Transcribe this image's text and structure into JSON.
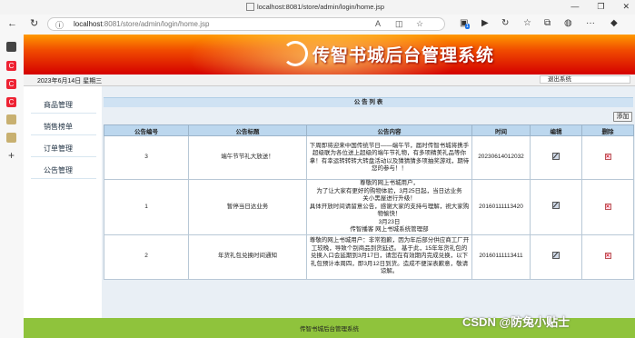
{
  "browser": {
    "tab_title": "localhost:8081/store/admin/login/home.jsp",
    "url_host": "localhost",
    "url_rest": ":8081/store/admin/login/home.jsp",
    "ext_badge": "1",
    "win_minimize": "—",
    "win_restore": "❐",
    "win_close": "✕"
  },
  "banner": {
    "title": "传智书城后台管理系统"
  },
  "infobar": {
    "date": "2023年6月14日 星期三",
    "logout": "退出系统"
  },
  "menu": {
    "items": [
      {
        "label": "商品管理"
      },
      {
        "label": "销售榜单"
      },
      {
        "label": "订单管理"
      },
      {
        "label": "公告管理"
      }
    ]
  },
  "panel": {
    "title": "公 告 列 表",
    "add_button": "添加"
  },
  "table": {
    "headers": [
      "公告编号",
      "公告标题",
      "公告内容",
      "时间",
      "编辑",
      "删除"
    ],
    "rows": [
      {
        "id": "3",
        "title": "端午节节礼大放送！",
        "content": "下周即将迎来中国传统节日——端午节，届时传智书城将携手超级联为各位送上超级的端午节礼物，有多项精美礼品等你拿！有幸运转转转大转盘活动以及猜猜猜多项抽奖游戏，期待您的参与！！",
        "time": "20230614012032"
      },
      {
        "id": "1",
        "title": "暂停当日达业务",
        "content": "尊敬的网上书城用户，\n为了让大家有更好的购物体验，3月25日起，当日达业务\n关小黑屋进行升级！\n具体开放时间请留意公告，感谢大家的支持与理解，祝大家购\n物愉快！\n3月23日\n传智播客 网上书城系统管理部",
        "time": "20160111113420"
      },
      {
        "id": "2",
        "title": "年货礼包兑换时间通知",
        "content": "尊敬的网上书城用户：非常抱歉，因为年后部分供应商工厂开工较晚，导致个别商品到货延迟。 基于此，15年年货礼包的兑换入口会延期到3月17日，请您在有效期内完成兑换，以下礼包预计本周四，即3月12日到货。造成不便深表歉意，敬请谅解。",
        "time": "20160111113411"
      }
    ]
  },
  "footer": {
    "text": "传智书城后台管理系统"
  },
  "watermark": {
    "text": "CSDN @防兔小贴士"
  },
  "colors": {
    "banner_top": "#ff9a00",
    "banner_bottom": "#d40000",
    "footer": "#8fc33c",
    "table_header": "#bcd7ee"
  }
}
